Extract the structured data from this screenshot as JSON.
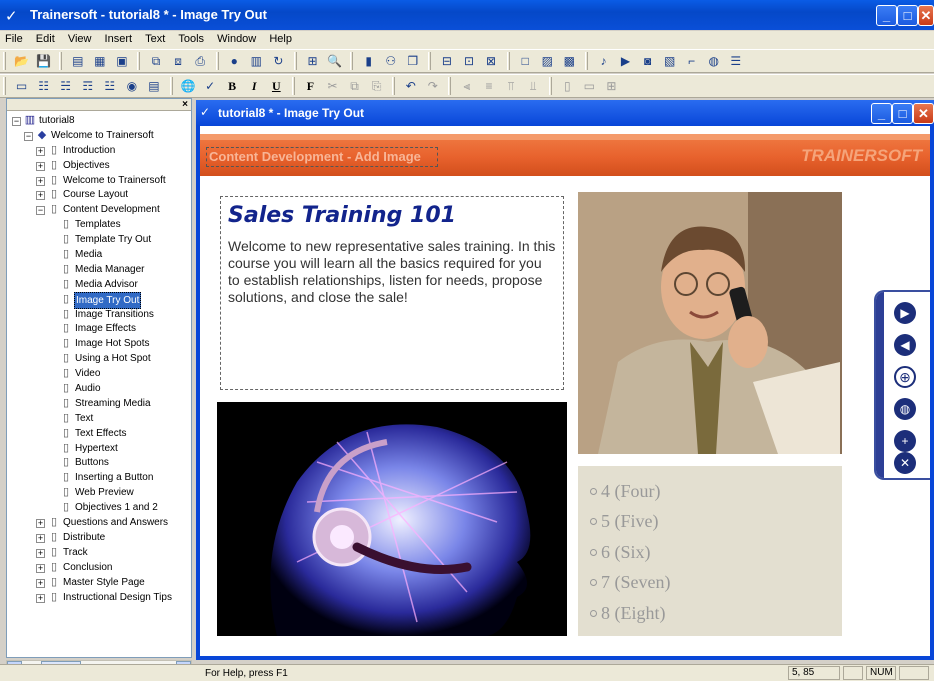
{
  "app": {
    "title": "Trainersoft - tutorial8 * - Image Try Out"
  },
  "menu": [
    "File",
    "Edit",
    "View",
    "Insert",
    "Text",
    "Tools",
    "Window",
    "Help"
  ],
  "toolbar": {
    "bold": "B",
    "italic": "I",
    "underline": "U",
    "font": "F"
  },
  "tree": {
    "root": "tutorial8",
    "course": "Welcome to Trainersoft",
    "top_items": [
      "Introduction",
      "Objectives",
      "Welcome to Trainersoft",
      "Course Layout",
      "Content Development"
    ],
    "children": [
      "Templates",
      "Template Try Out",
      "Media",
      "Media Manager",
      "Media Advisor",
      "Image Try Out",
      "Image Transitions",
      "Image Effects",
      "Image Hot Spots",
      "Using a Hot Spot",
      "Video",
      "Audio",
      "Streaming Media",
      "Text",
      "Text Effects",
      "Hypertext",
      "Buttons",
      "Inserting a Button",
      "Web Preview",
      "Objectives 1 and 2"
    ],
    "bottom_items": [
      "Questions and Answers",
      "Distribute",
      "Track",
      "Conclusion",
      "Master Style Page",
      "Instructional Design Tips"
    ],
    "selected": "Image Try Out"
  },
  "inner_window": {
    "title": "tutorial8 * - Image Try Out"
  },
  "banner": {
    "subtitle": "Content Development - Add Image",
    "brand": "TRAINERSOFT"
  },
  "content": {
    "heading": "Sales Training 101",
    "body": "Welcome to new representative sales training. In this course you will learn all the basics required for you to establish relationships, listen for needs, propose solutions, and close the sale!"
  },
  "radio_options": [
    "4 (Four)",
    "5 (Five)",
    "6 (Six)",
    "7 (Seven)",
    "8 (Eight)"
  ],
  "statusbar": {
    "help": "For Help, press F1",
    "position": "5, 85",
    "num": "NUM"
  },
  "colors": {
    "titlebar": "#0548c8",
    "banner": "#e8622d",
    "heading": "#12248c",
    "nav": "#1c2e7a"
  }
}
